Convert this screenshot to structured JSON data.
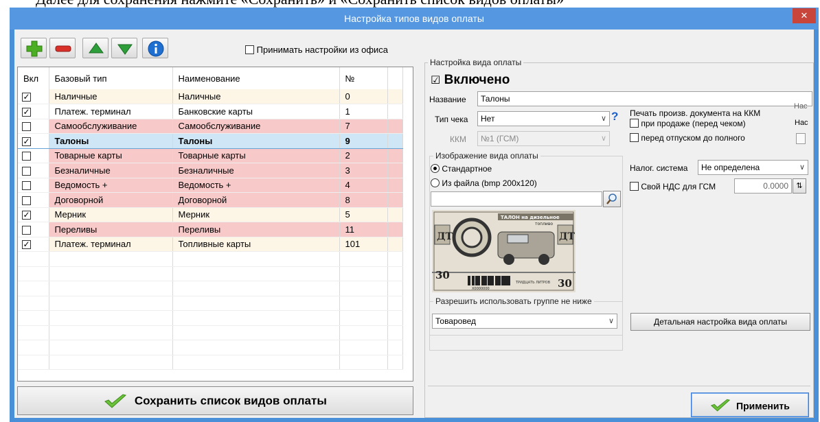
{
  "doc_background_text": "Далее для сохранения нажмите «Сохранить» и «Сохранить список видов оплаты»",
  "window": {
    "title": "Настройка типов видов оплаты",
    "close_glyph": "✕"
  },
  "toolbar": {
    "icons": [
      "add-icon",
      "remove-icon",
      "move-up-icon",
      "move-down-icon",
      "info-icon"
    ],
    "office_settings_label": "Принимать настройки из офиса",
    "office_settings_checked": false
  },
  "grid": {
    "columns": [
      "Вкл",
      "Базовый тип",
      "Наименование",
      "№"
    ],
    "rows": [
      {
        "enabled": true,
        "base": "Наличные",
        "name": "Наличные",
        "num": "0",
        "style": "cream"
      },
      {
        "enabled": true,
        "base": "Платеж. терминал",
        "name": "Банковские карты",
        "num": "1",
        "style": "plain"
      },
      {
        "enabled": false,
        "base": "Самообслуживание",
        "name": "Самообслуживание",
        "num": "7",
        "style": "pink"
      },
      {
        "enabled": true,
        "base": "Талоны",
        "name": "Талоны",
        "num": "9",
        "style": "sel"
      },
      {
        "enabled": false,
        "base": "Товарные карты",
        "name": "Товарные карты",
        "num": "2",
        "style": "pink"
      },
      {
        "enabled": false,
        "base": "Безналичные",
        "name": "Безналичные",
        "num": "3",
        "style": "pink"
      },
      {
        "enabled": false,
        "base": "Ведомость +",
        "name": "Ведомость +",
        "num": "4",
        "style": "pink"
      },
      {
        "enabled": false,
        "base": "Договорной",
        "name": "Договорной",
        "num": "8",
        "style": "pink"
      },
      {
        "enabled": true,
        "base": "Мерник",
        "name": "Мерник",
        "num": "5",
        "style": "cream"
      },
      {
        "enabled": false,
        "base": "Переливы",
        "name": "Переливы",
        "num": "11",
        "style": "pink"
      },
      {
        "enabled": true,
        "base": "Платеж. терминал",
        "name": "Топливные карты",
        "num": "101",
        "style": "cream"
      }
    ]
  },
  "save_list_button": "Сохранить список видов оплаты",
  "settings": {
    "group_title": "Настройка вида оплаты",
    "enabled_label": "Включено",
    "enabled_checked": true,
    "name_label": "Название",
    "name_value": "Талоны",
    "receipt_type_label": "Тип чека",
    "receipt_type_value": "Нет",
    "help_glyph": "?",
    "kkm_label": "ККМ",
    "kkm_value": "№1 (ГСМ)",
    "print_group_label": "Печать произв. документа на ККМ",
    "print_on_sale_label": "при продаже (перед чеком)",
    "print_before_full_label": "перед отпуском до полного",
    "side_text_1": "Нас",
    "side_text_2": "Нас",
    "image_group_label": "Изображение вида оплаты",
    "image_standard_label": "Стандартное",
    "image_file_label": "Из файла (bmp 200х120)",
    "image_file_value": "",
    "ticket": {
      "top_text": "ТАЛОН на дизельное",
      "top_text2": "топливо",
      "code": "ДТ",
      "number": "30",
      "number_words": "ТРИДЦАТЬ ЛИТРОВ",
      "serial": "Х0000000"
    },
    "tax_label": "Налог. система",
    "tax_value": "Не определена",
    "own_vat_label": "Свой НДС для ГСМ",
    "own_vat_value": "0.0000",
    "group_min_label": "Разрешить использовать группе не ниже",
    "group_min_value": "Товаровед",
    "detail_button": "Детальная настройка вида оплаты",
    "apply_button": "Применить"
  },
  "colors": {
    "title_bar": "#5597e1",
    "row_pink": "#f8c9c9",
    "row_cream": "#fdf5e6",
    "row_selected": "#cfe6f7",
    "check_icon": "#5aae2e"
  }
}
